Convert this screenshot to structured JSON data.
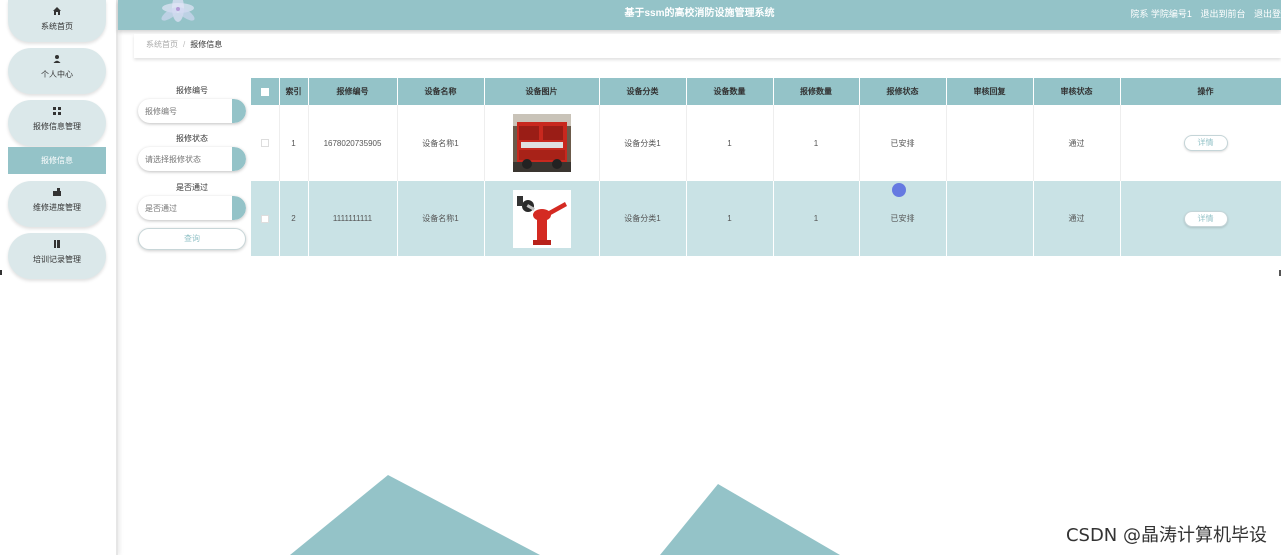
{
  "header": {
    "title": "基于ssm的高校消防设施管理系统",
    "user_info": "院系 学院编号1",
    "logout1": "退出到前台",
    "logout2": "退出登"
  },
  "sidebar": {
    "items": [
      {
        "label": "系统首页",
        "icon": "home-icon"
      },
      {
        "label": "个人中心",
        "icon": "user-icon"
      },
      {
        "label": "报修信息管理",
        "icon": "grid-icon"
      },
      {
        "label": "维修进度管理",
        "icon": "progress-icon"
      },
      {
        "label": "培训记录管理",
        "icon": "book-icon"
      }
    ],
    "active_sub": "报修信息"
  },
  "breadcrumb": {
    "home": "系统首页",
    "separator": "/",
    "current": "报修信息"
  },
  "search": {
    "repair_no_label": "报修编号",
    "repair_no_placeholder": "报修编号",
    "repair_status_label": "报修状态",
    "repair_status_placeholder": "请选择报修状态",
    "passed_label": "是否通过",
    "passed_placeholder": "是否通过",
    "query_button": "查询"
  },
  "table": {
    "columns": [
      "索引",
      "报修编号",
      "设备名称",
      "设备图片",
      "设备分类",
      "设备数量",
      "报修数量",
      "报修状态",
      "审核回复",
      "审核状态",
      "操作"
    ],
    "rows": [
      {
        "index": "1",
        "repair_no": "1678020735905",
        "device_name": "设备名称1",
        "category": "设备分类1",
        "device_qty": "1",
        "repair_qty": "1",
        "repair_status": "已安排",
        "reply": "",
        "audit_status": "通过",
        "action": "详情"
      },
      {
        "index": "2",
        "repair_no": "1111111111",
        "device_name": "设备名称1",
        "category": "设备分类1",
        "device_qty": "1",
        "repair_qty": "1",
        "repair_status": "已安排",
        "reply": "",
        "audit_status": "通过",
        "action": "详情"
      }
    ]
  },
  "watermark": "CSDN @晶涛计算机毕设",
  "colors": {
    "accent": "#94c3c8",
    "row_alt": "#c9e2e5",
    "menu_bg": "#dbe8ea"
  }
}
